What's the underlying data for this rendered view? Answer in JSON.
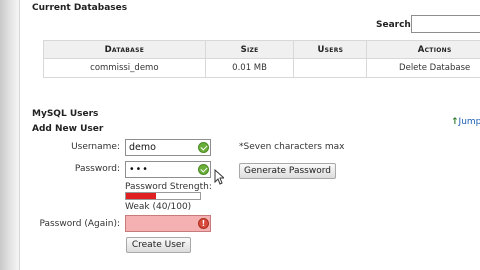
{
  "databases": {
    "heading": "Current Databases",
    "search_label": "Search",
    "search_value": "",
    "columns": [
      "Database",
      "Size",
      "Users",
      "Actions"
    ],
    "rows": [
      {
        "database": "commissi_demo",
        "size": "0.01 MB",
        "users": "",
        "action": "Delete Database"
      }
    ]
  },
  "users": {
    "heading": "MySQL Users",
    "jump_link": "Jump",
    "add_heading": "Add New User",
    "username_label": "Username:",
    "username_value": "demo",
    "password_label": "Password:",
    "password_value": "•••",
    "password_hint": "*Seven characters max",
    "generate_button": "Generate Password",
    "strength_label": "Password Strength:",
    "strength_text": "Weak (40/100)",
    "strength_value": 0.4,
    "password_again_label": "Password (Again):",
    "password_again_value": "",
    "create_button": "Create User"
  },
  "colors": {
    "link": "#1a5fb4",
    "ok": "#6aae3a",
    "error_field": "#f5b1b1",
    "strength_bar": "#e02020"
  }
}
